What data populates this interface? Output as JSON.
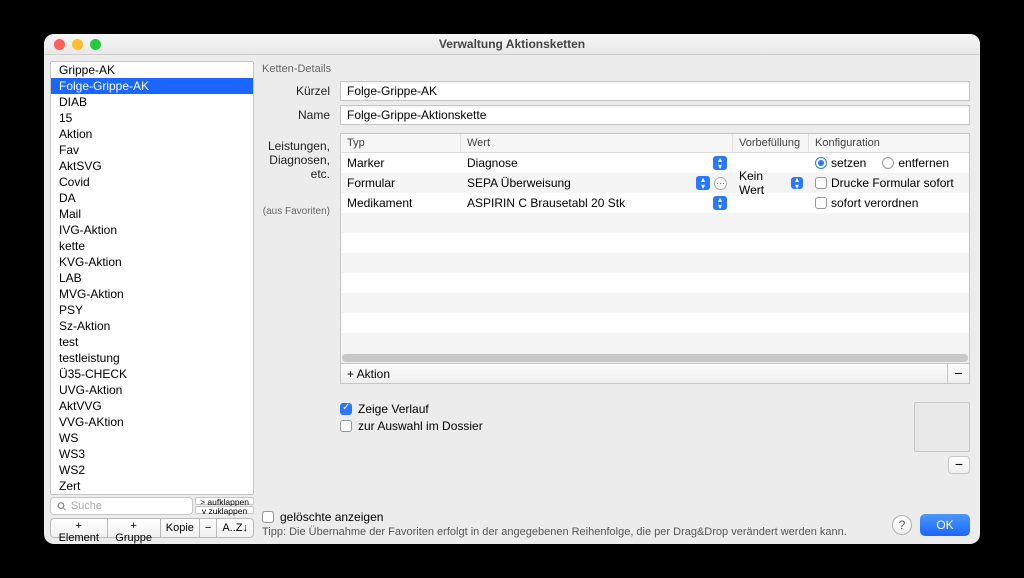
{
  "window": {
    "title": "Verwaltung Aktionsketten"
  },
  "sidebar": {
    "items": [
      "Grippe-AK",
      "Folge-Grippe-AK",
      "DIAB",
      "15",
      "Aktion",
      "Fav",
      "AktSVG",
      "Covid",
      "DA",
      "Mail",
      "IVG-Aktion",
      "kette",
      "KVG-Aktion",
      "LAB",
      "MVG-Aktion",
      "PSY",
      "Sz-Aktion",
      "test",
      "testleistung",
      "Ü35-CHECK",
      "UVG-Aktion",
      "AktVVG",
      "VVG-AKtion",
      "WS",
      "WS3",
      "WS2",
      "Zert"
    ],
    "selectedIndex": 1,
    "search_placeholder": "Suche",
    "expand": "> aufklappen",
    "collapse": "v zuklappen",
    "btn_element": "+ Element",
    "btn_gruppe": "+ Gruppe",
    "btn_kopie": "Kopie",
    "btn_minus": "−",
    "btn_sort": "A..Z↓"
  },
  "details": {
    "group_label": "Ketten-Details",
    "kuerzel_label": "Kürzel",
    "kuerzel_value": "Folge-Grippe-AK",
    "name_label": "Name",
    "name_value": "Folge-Grippe-Aktionskette",
    "rows_label_1": "Leistungen,",
    "rows_label_2": "Diagnosen,",
    "rows_label_3": "etc.",
    "rows_sub": "(aus Favoriten)",
    "columns": {
      "typ": "Typ",
      "wert": "Wert",
      "vor": "Vorbefüllung",
      "konf": "Konfiguration"
    },
    "rows": [
      {
        "typ": "Marker",
        "wert": "Diagnose",
        "vor": "",
        "konf_setzen": "setzen",
        "konf_entfernen": "entfernen"
      },
      {
        "typ": "Formular",
        "wert": "SEPA Überweisung",
        "vor": "Kein Wert",
        "konf_chk": "Drucke Formular sofort"
      },
      {
        "typ": "Medikament",
        "wert": "ASPIRIN C Brausetabl 20 Stk",
        "vor": "",
        "konf_chk": "sofort verordnen"
      }
    ],
    "add_action": "+ Aktion",
    "chk_verlauf": "Zeige Verlauf",
    "chk_dossier": "zur Auswahl im Dossier"
  },
  "footer": {
    "show_deleted": "gelöschte anzeigen",
    "tip": "Tipp: Die Übernahme der Favoriten erfolgt in der angegebenen Reihenfolge, die per Drag&Drop verändert werden kann.",
    "help": "?",
    "ok": "OK"
  }
}
